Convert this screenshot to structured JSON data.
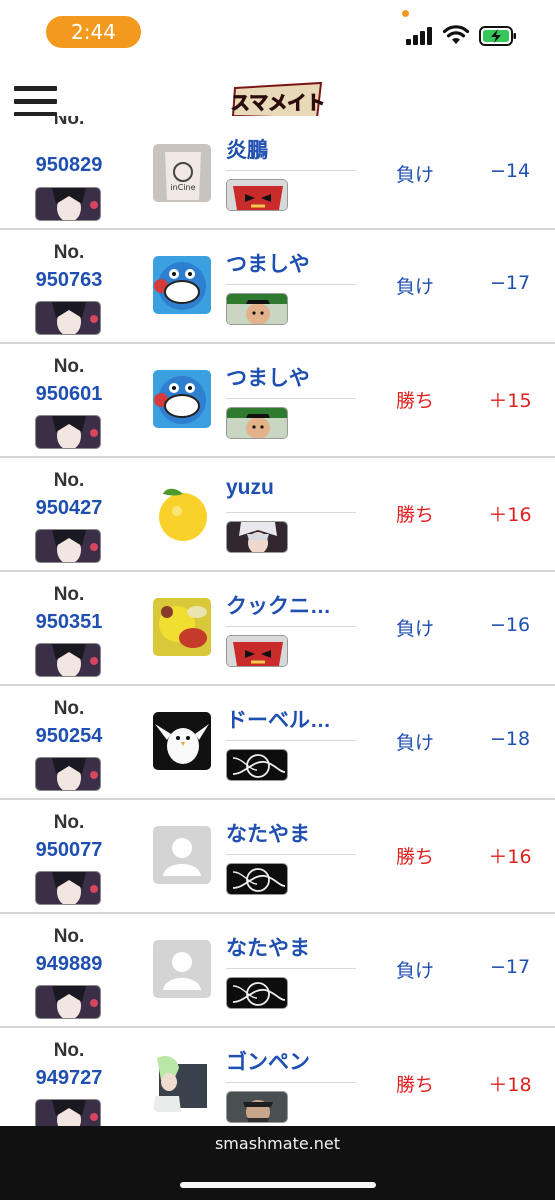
{
  "status_bar": {
    "time": "2:44",
    "battery_state": "charging"
  },
  "header": {
    "logo_text": "スマメイト",
    "menu_icon": "hamburger-menu-icon"
  },
  "colors": {
    "lose": "#1f4fb0",
    "win": "#e12020",
    "match_number": "#1f4fb0",
    "status_pill": "#f39a1e"
  },
  "matches": [
    {
      "no_label": "No.",
      "number": "950829",
      "opponent": "炎鵬",
      "result": "負け",
      "outcome": "lose",
      "rating": "−14",
      "avatar": "photo-avatar",
      "my_character": "bayonetta",
      "opp_character": "incineroar"
    },
    {
      "no_label": "No.",
      "number": "950763",
      "opponent": "つましや",
      "result": "負け",
      "outcome": "lose",
      "rating": "−17",
      "avatar": "cartoon-avatar",
      "my_character": "bayonetta",
      "opp_character": "little-mac"
    },
    {
      "no_label": "No.",
      "number": "950601",
      "opponent": "つましや",
      "result": "勝ち",
      "outcome": "win",
      "rating": "＋15",
      "avatar": "cartoon-avatar",
      "my_character": "bayonetta",
      "opp_character": "little-mac"
    },
    {
      "no_label": "No.",
      "number": "950427",
      "opponent": "yuzu",
      "result": "勝ち",
      "outcome": "win",
      "rating": "＋16",
      "avatar": "yuzu-avatar",
      "my_character": "bayonetta",
      "opp_character": "robin"
    },
    {
      "no_label": "No.",
      "number": "950351",
      "opponent": "クックニ…",
      "result": "負け",
      "outcome": "lose",
      "rating": "−16",
      "avatar": "blur-avatar",
      "my_character": "bayonetta",
      "opp_character": "incineroar"
    },
    {
      "no_label": "No.",
      "number": "950254",
      "opponent": "ドーベル…",
      "result": "負け",
      "outcome": "lose",
      "rating": "−18",
      "avatar": "bird-avatar",
      "my_character": "bayonetta",
      "opp_character": "unknown-character"
    },
    {
      "no_label": "No.",
      "number": "950077",
      "opponent": "なたやま",
      "result": "勝ち",
      "outcome": "win",
      "rating": "＋16",
      "avatar": "default-avatar",
      "my_character": "bayonetta",
      "opp_character": "unknown-character"
    },
    {
      "no_label": "No.",
      "number": "949889",
      "opponent": "なたやま",
      "result": "負け",
      "outcome": "lose",
      "rating": "−17",
      "avatar": "default-avatar",
      "my_character": "bayonetta",
      "opp_character": "unknown-character"
    },
    {
      "no_label": "No.",
      "number": "949727",
      "opponent": "ゴンペン",
      "result": "勝ち",
      "outcome": "win",
      "rating": "＋18",
      "avatar": "anime-avatar",
      "my_character": "bayonetta",
      "opp_character": "snake"
    }
  ],
  "footer": {
    "site": "smashmate.net"
  }
}
